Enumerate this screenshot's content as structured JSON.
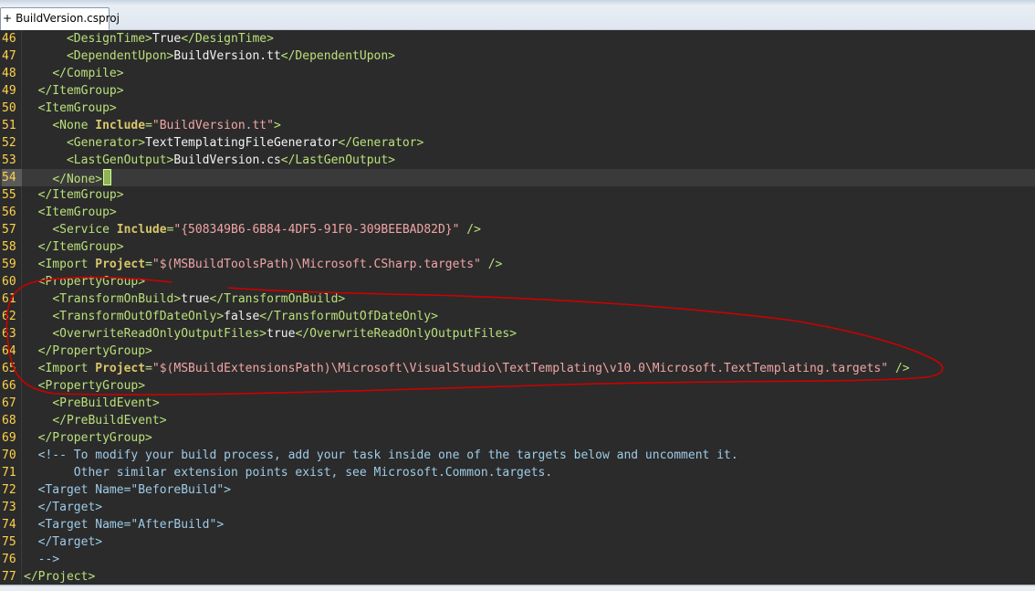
{
  "tab": {
    "pin": "+",
    "title": "BuildVersion.csproj"
  },
  "colors": {
    "background": "#2b2b2b",
    "line_number": "#ffd24a",
    "tag": "#b9e07a",
    "attribute": "#d9c66a",
    "attribute_value": "#f0a5a5",
    "comment": "#9ecbe8",
    "annotation": "#cc0000"
  },
  "editor": {
    "current_line": "54",
    "lines": [
      {
        "n": "46",
        "indent": "      ",
        "t1": "<DesignTime>",
        "t2": "True",
        "t3": "</DesignTime>"
      },
      {
        "n": "47",
        "indent": "      ",
        "t1": "<DependentUpon>",
        "t2": "BuildVersion.tt",
        "t3": "</DependentUpon>"
      },
      {
        "n": "48",
        "indent": "    ",
        "t1": "</Compile>"
      },
      {
        "n": "49",
        "indent": "  ",
        "t1": "</ItemGroup>"
      },
      {
        "n": "50",
        "indent": "  ",
        "t1": "<ItemGroup>"
      },
      {
        "n": "51",
        "indent": "    ",
        "t1": "<None ",
        "a1": "Include",
        "eq": "=",
        "v1": "\"BuildVersion.tt\"",
        "t3": ">"
      },
      {
        "n": "52",
        "indent": "      ",
        "t1": "<Generator>",
        "t2": "TextTemplatingFileGenerator",
        "t3": "</Generator>"
      },
      {
        "n": "53",
        "indent": "      ",
        "t1": "<LastGenOutput>",
        "t2": "BuildVersion.cs",
        "t3": "</LastGenOutput>"
      },
      {
        "n": "54",
        "indent": "    ",
        "t1": "</None",
        "t3": ">"
      },
      {
        "n": "55",
        "indent": "  ",
        "t1": "</ItemGroup>"
      },
      {
        "n": "56",
        "indent": "  ",
        "t1": "<ItemGroup>"
      },
      {
        "n": "57",
        "indent": "    ",
        "t1": "<Service ",
        "a1": "Include",
        "eq": "=",
        "v1": "\"{508349B6-6B84-4DF5-91F0-309BEEBAD82D}\"",
        "t3": " />"
      },
      {
        "n": "58",
        "indent": "  ",
        "t1": "</ItemGroup>"
      },
      {
        "n": "59",
        "indent": "  ",
        "t1": "<Import ",
        "a1": "Project",
        "eq": "=",
        "v1": "\"$(MSBuildToolsPath)\\Microsoft.CSharp.targets\"",
        "t3": " />"
      },
      {
        "n": "60",
        "indent": "  ",
        "t1": "<PropertyGroup>"
      },
      {
        "n": "61",
        "indent": "    ",
        "t1": "<TransformOnBuild>",
        "t2": "true",
        "t3": "</TransformOnBuild>"
      },
      {
        "n": "62",
        "indent": "    ",
        "t1": "<TransformOutOfDateOnly>",
        "t2": "false",
        "t3": "</TransformOutOfDateOnly>"
      },
      {
        "n": "63",
        "indent": "    ",
        "t1": "<OverwriteReadOnlyOutputFiles>",
        "t2": "true",
        "t3": "</OverwriteReadOnlyOutputFiles>"
      },
      {
        "n": "64",
        "indent": "  ",
        "t1": "</PropertyGroup>"
      },
      {
        "n": "65",
        "indent": "  ",
        "t1": "<Import ",
        "a1": "Project",
        "eq": "=",
        "v1": "\"$(MSBuildExtensionsPath)\\Microsoft\\VisualStudio\\TextTemplating\\v10.0\\Microsoft.TextTemplating.targets\"",
        "t3": " />"
      },
      {
        "n": "66",
        "indent": "  ",
        "t1": "<PropertyGroup>"
      },
      {
        "n": "67",
        "indent": "    ",
        "t1": "<PreBuildEvent>"
      },
      {
        "n": "68",
        "indent": "    ",
        "t1": "</PreBuildEvent>"
      },
      {
        "n": "69",
        "indent": "  ",
        "t1": "</PropertyGroup>"
      },
      {
        "n": "70",
        "indent": "  ",
        "c": "<!-- To modify your build process, add your task inside one of the targets below and uncomment it."
      },
      {
        "n": "71",
        "indent": "       ",
        "c": "Other similar extension points exist, see Microsoft.Common.targets."
      },
      {
        "n": "72",
        "indent": "  ",
        "c": "<Target Name=\"BeforeBuild\">"
      },
      {
        "n": "73",
        "indent": "  ",
        "c": "</Target>"
      },
      {
        "n": "74",
        "indent": "  ",
        "c": "<Target Name=\"AfterBuild\">"
      },
      {
        "n": "75",
        "indent": "  ",
        "c": "</Target>"
      },
      {
        "n": "76",
        "indent": "  ",
        "c": "-->"
      },
      {
        "n": "77",
        "indent": "",
        "t1": "</Project>"
      }
    ]
  }
}
